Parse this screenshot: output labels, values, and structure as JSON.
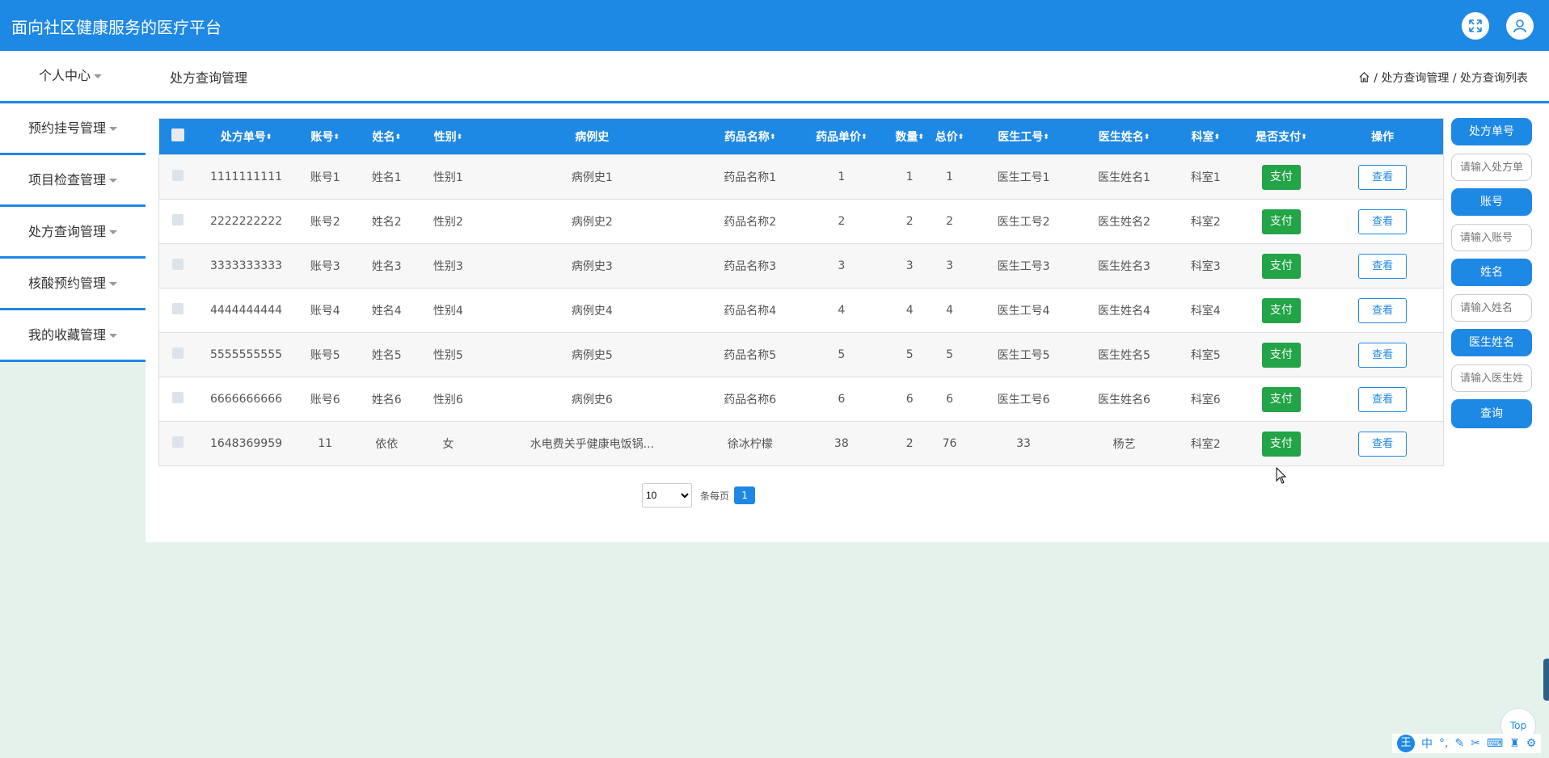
{
  "app": {
    "title": "面向社区健康服务的医疗平台"
  },
  "header": {
    "personal_center": "个人中心",
    "page_title": "处方查询管理"
  },
  "breadcrumb": {
    "level1": "处方查询管理",
    "level2": "处方查询列表",
    "sep": "/"
  },
  "sidebar": {
    "items": [
      {
        "label": "预约挂号管理"
      },
      {
        "label": "项目检查管理"
      },
      {
        "label": "处方查询管理"
      },
      {
        "label": "核酸预约管理"
      },
      {
        "label": "我的收藏管理"
      }
    ]
  },
  "table": {
    "columns": [
      "处方单号",
      "账号",
      "姓名",
      "性别",
      "病例史",
      "药品名称",
      "药品单价",
      "数量",
      "总价",
      "医生工号",
      "医生姓名",
      "科室",
      "是否支付",
      "操作"
    ],
    "sort_icon": "⬍",
    "pay_label": "支付",
    "view_label": "查看",
    "rows": [
      [
        "1111111111",
        "账号1",
        "姓名1",
        "性别1",
        "病例史1",
        "药品名称1",
        "1",
        "1",
        "1",
        "医生工号1",
        "医生姓名1",
        "科室1"
      ],
      [
        "2222222222",
        "账号2",
        "姓名2",
        "性别2",
        "病例史2",
        "药品名称2",
        "2",
        "2",
        "2",
        "医生工号2",
        "医生姓名2",
        "科室2"
      ],
      [
        "3333333333",
        "账号3",
        "姓名3",
        "性别3",
        "病例史3",
        "药品名称3",
        "3",
        "3",
        "3",
        "医生工号3",
        "医生姓名3",
        "科室3"
      ],
      [
        "4444444444",
        "账号4",
        "姓名4",
        "性别4",
        "病例史4",
        "药品名称4",
        "4",
        "4",
        "4",
        "医生工号4",
        "医生姓名4",
        "科室4"
      ],
      [
        "5555555555",
        "账号5",
        "姓名5",
        "性别5",
        "病例史5",
        "药品名称5",
        "5",
        "5",
        "5",
        "医生工号5",
        "医生姓名5",
        "科室5"
      ],
      [
        "6666666666",
        "账号6",
        "姓名6",
        "性别6",
        "病例史6",
        "药品名称6",
        "6",
        "6",
        "6",
        "医生工号6",
        "医生姓名6",
        "科室6"
      ],
      [
        "1648369959",
        "11",
        "依依",
        "女",
        "水电费关乎健康电饭锅...",
        "徐冰柠檬",
        "38",
        "2",
        "76",
        "33",
        "杨艺",
        "科室2"
      ]
    ]
  },
  "pagination": {
    "page_size": "10",
    "per_page_label": "条每页",
    "current_page": "1"
  },
  "search": {
    "rx_label": "处方单号",
    "rx_placeholder": "请输入处方单号",
    "account_label": "账号",
    "account_placeholder": "请输入账号",
    "name_label": "姓名",
    "name_placeholder": "请输入姓名",
    "doctor_label": "医生姓名",
    "doctor_placeholder": "请输入医生姓名",
    "query_button": "查询"
  },
  "misc": {
    "top_label": "Top",
    "ime_logo": "王",
    "ime_lang": "中"
  },
  "colors": {
    "primary": "#1e88e5",
    "pay": "#22a447",
    "background": "#e5f2ec"
  }
}
